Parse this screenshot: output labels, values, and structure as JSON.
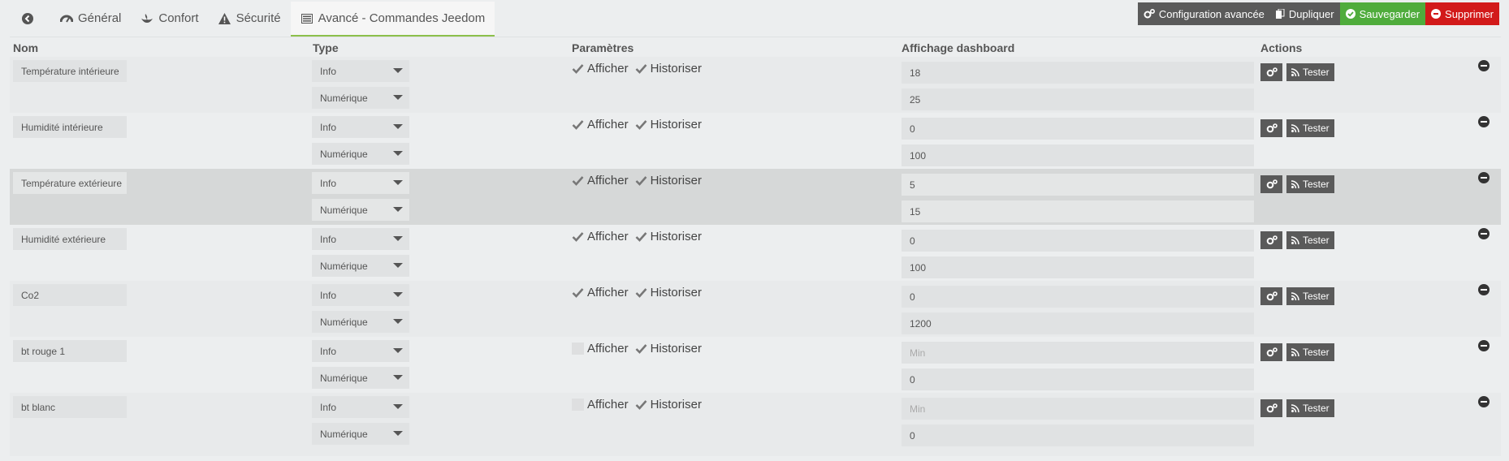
{
  "tabs": [
    {
      "label": "",
      "icon": "back-arrow-icon"
    },
    {
      "label": "Général",
      "icon": "dashboard-icon"
    },
    {
      "label": "Confort",
      "icon": "plant-icon"
    },
    {
      "label": "Sécurité",
      "icon": "warning-icon"
    },
    {
      "label": "Avancé - Commandes Jeedom",
      "icon": "list-icon"
    }
  ],
  "toolbar": {
    "config_label": "Configuration avancée",
    "duplicate_label": "Dupliquer",
    "save_label": "Sauvegarder",
    "delete_label": "Supprimer"
  },
  "colors": {
    "accent_green": "#4fac3c",
    "danger_red": "#d21a1a",
    "dark_button": "#5a5a5a",
    "tab_underline": "#8cc04b"
  },
  "table": {
    "headers": {
      "name": "Nom",
      "type": "Type",
      "params": "Paramètres",
      "dashboard": "Affichage dashboard",
      "actions": "Actions"
    },
    "rows": [
      {
        "name": "Température intérieure",
        "type": "Info",
        "subtype": "Numérique",
        "afficher": "Afficher",
        "historiser": "Historiser",
        "show_checked": true,
        "hist_checked": true,
        "min": "18",
        "max": "25",
        "test_label": "Tester"
      },
      {
        "name": "Humidité intérieure",
        "type": "Info",
        "subtype": "Numérique",
        "afficher": "Afficher",
        "historiser": "Historiser",
        "show_checked": true,
        "hist_checked": true,
        "min": "0",
        "max": "100",
        "test_label": "Tester"
      },
      {
        "name": "Température extérieure",
        "type": "Info",
        "subtype": "Numérique",
        "afficher": "Afficher",
        "historiser": "Historiser",
        "show_checked": true,
        "hist_checked": true,
        "min": "5",
        "max": "15",
        "test_label": "Tester"
      },
      {
        "name": "Humidité extérieure",
        "type": "Info",
        "subtype": "Numérique",
        "afficher": "Afficher",
        "historiser": "Historiser",
        "show_checked": true,
        "hist_checked": true,
        "min": "0",
        "max": "100",
        "test_label": "Tester"
      },
      {
        "name": "Co2",
        "type": "Info",
        "subtype": "Numérique",
        "afficher": "Afficher",
        "historiser": "Historiser",
        "show_checked": true,
        "hist_checked": true,
        "min": "0",
        "max": "1200",
        "test_label": "Tester"
      },
      {
        "name": "bt rouge 1",
        "type": "Info",
        "subtype": "Numérique",
        "afficher": "Afficher",
        "historiser": "Historiser",
        "show_checked": false,
        "hist_checked": true,
        "min_placeholder": "Min",
        "max": "0",
        "test_label": "Tester"
      },
      {
        "name": "bt blanc",
        "type": "Info",
        "subtype": "Numérique",
        "afficher": "Afficher",
        "historiser": "Historiser",
        "show_checked": false,
        "hist_checked": true,
        "min_placeholder": "Min",
        "max": "0",
        "test_label": "Tester"
      }
    ]
  }
}
